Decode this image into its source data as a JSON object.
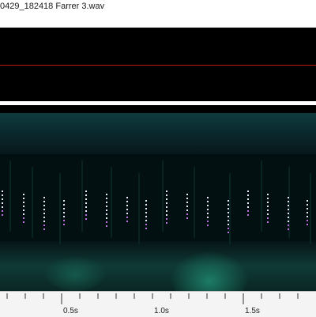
{
  "window": {
    "title": "0429_182418 Farrer 3.wav"
  },
  "waveform": {
    "trace_color": "#b21818",
    "background": "#000000"
  },
  "spectrogram": {
    "background": "#020a0c",
    "low_color": "#1f7a6e",
    "call_color": "#e8e8f8",
    "call_accent": "#c070e0"
  },
  "time_axis": {
    "labels": [
      {
        "text": "0.5s",
        "seconds": 0.5
      },
      {
        "text": "1.0s",
        "seconds": 1.0
      },
      {
        "text": "1.5s",
        "seconds": 1.5
      }
    ]
  }
}
